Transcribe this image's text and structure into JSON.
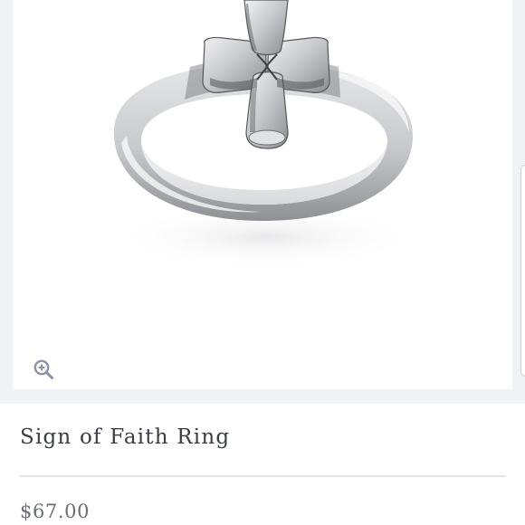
{
  "product": {
    "image_alt": "Sign of Faith Ring",
    "zoom_icon": "zoom-in-icon",
    "title": "Sign of Faith Ring",
    "price": "$67.00"
  },
  "colors": {
    "page_background": "#ffffff",
    "image_frame_background": "#f1f2f5",
    "title_text": "#3a3d44",
    "price_text": "#6a6d74",
    "divider": "#e3e5ea",
    "zoom_icon": "#8c93a8"
  }
}
